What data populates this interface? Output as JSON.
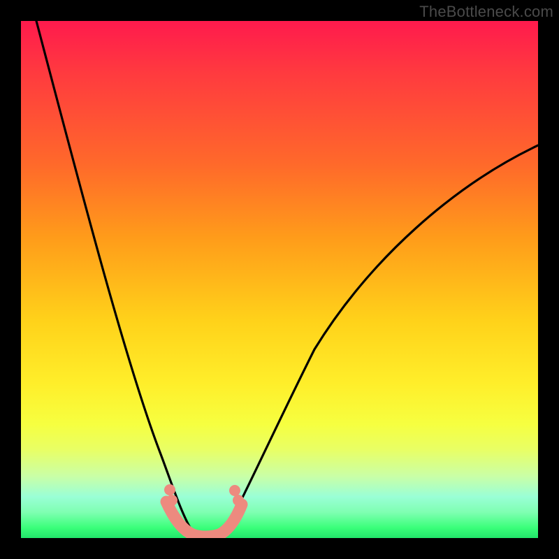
{
  "attribution": "TheBottleneck.com",
  "chart_data": {
    "type": "line",
    "title": "",
    "xlabel": "",
    "ylabel": "",
    "xlim": [
      0,
      100
    ],
    "ylim": [
      0,
      100
    ],
    "background_gradient": {
      "orientation": "vertical",
      "note": "color encodes y-value (red→yellow→green bottom)",
      "stops": [
        {
          "pos": 0,
          "color": "#ff1a4d"
        },
        {
          "pos": 28,
          "color": "#ff6a2a"
        },
        {
          "pos": 58,
          "color": "#ffd21a"
        },
        {
          "pos": 78,
          "color": "#f6ff40"
        },
        {
          "pos": 92,
          "color": "#9affd6"
        },
        {
          "pos": 100,
          "color": "#22e66a"
        }
      ]
    },
    "series": [
      {
        "name": "curve",
        "color": "#000000",
        "x": [
          3,
          10,
          16,
          20,
          23,
          26,
          28,
          30,
          32,
          34,
          36,
          38,
          40,
          46,
          54,
          62,
          70,
          78,
          86,
          94,
          100
        ],
        "y": [
          100,
          76,
          56,
          40,
          26,
          15,
          8,
          3,
          1,
          0,
          1,
          3,
          7,
          18,
          32,
          44,
          54,
          62,
          68,
          73,
          76
        ]
      },
      {
        "name": "marker-band",
        "type": "scatter",
        "color": "#ed8a7f",
        "note": "thick salmon markers near valley bottom",
        "x": [
          27.5,
          28.5,
          30,
          31,
          32,
          33,
          34,
          35,
          36,
          37,
          38,
          39,
          39.8,
          40.5
        ],
        "y": [
          7,
          5,
          2,
          1,
          0.5,
          0.5,
          0.5,
          0.5,
          0.7,
          1,
          2,
          4,
          6,
          8
        ]
      }
    ]
  }
}
